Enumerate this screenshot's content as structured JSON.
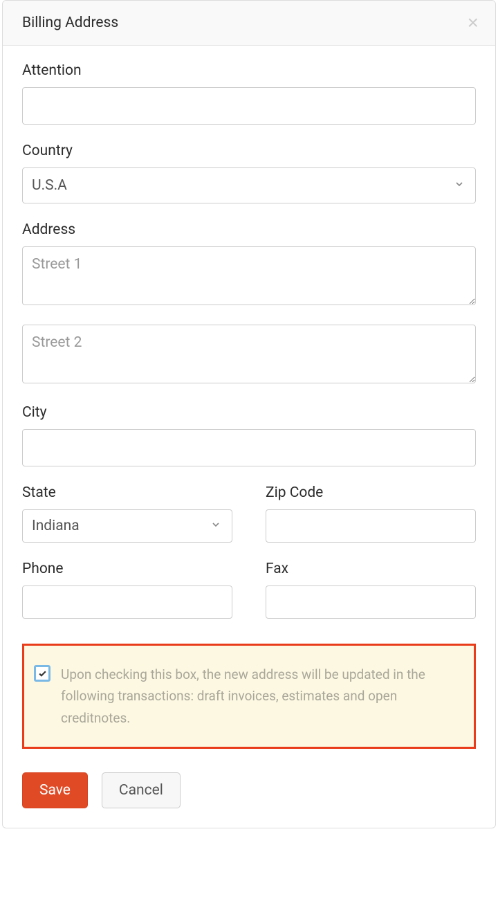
{
  "modal": {
    "title": "Billing Address",
    "close_symbol": "×"
  },
  "fields": {
    "attention": {
      "label": "Attention",
      "value": ""
    },
    "country": {
      "label": "Country",
      "value": "U.S.A"
    },
    "address": {
      "label": "Address",
      "street1_placeholder": "Street 1",
      "street1_value": "",
      "street2_placeholder": "Street 2",
      "street2_value": ""
    },
    "city": {
      "label": "City",
      "value": ""
    },
    "state": {
      "label": "State",
      "value": "Indiana"
    },
    "zip": {
      "label": "Zip Code",
      "value": ""
    },
    "phone": {
      "label": "Phone",
      "value": ""
    },
    "fax": {
      "label": "Fax",
      "value": ""
    }
  },
  "notice": {
    "checked": true,
    "text": "Upon checking this box, the new address will be updated in the following transactions: draft invoices, estimates and open creditnotes."
  },
  "actions": {
    "save": "Save",
    "cancel": "Cancel"
  }
}
